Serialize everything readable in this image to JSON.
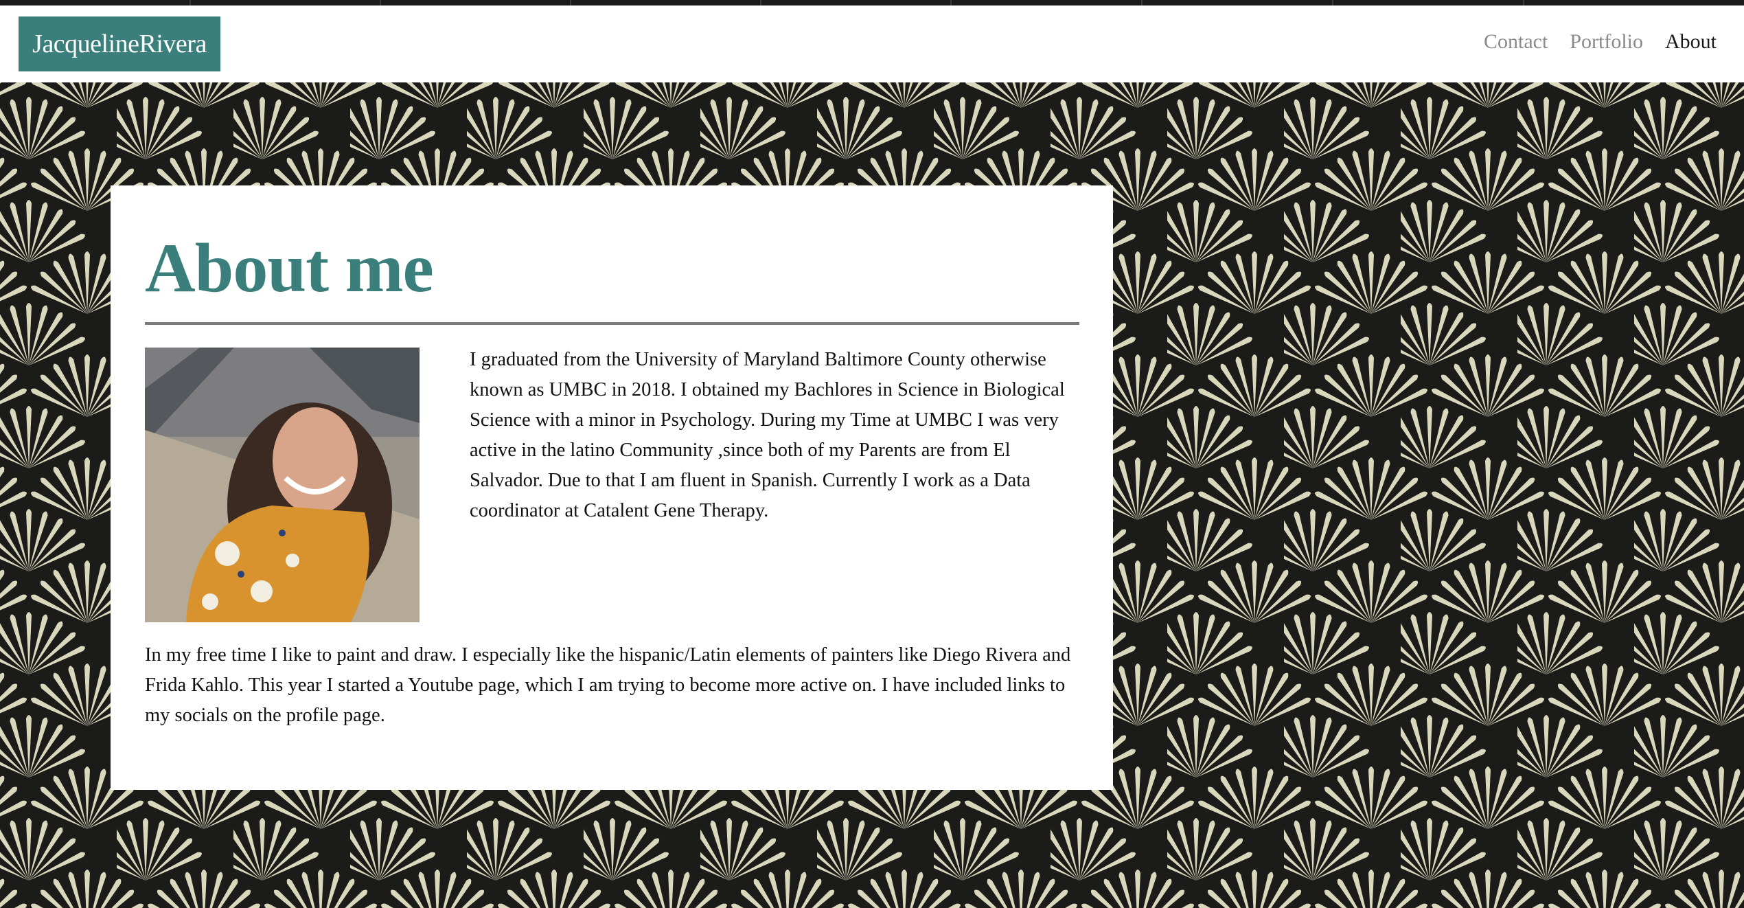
{
  "header": {
    "brand": "JacquelineRivera",
    "nav": [
      {
        "label": "Contact",
        "active": false
      },
      {
        "label": "Portfolio",
        "active": false
      },
      {
        "label": "About",
        "active": true
      }
    ]
  },
  "main": {
    "title": "About me",
    "bio_paragraph_1": "I graduated from the University of Maryland Baltimore County otherwise known as UMBC in 2018. I obtained my Bachlores in Science in Biological Science with a minor in Psychology. During my Time at UMBC I was very active in the latino Community ,since both of my Parents are from El Salvador. Due to that I am fluent in Spanish. Currently I work as a Data coordinator at Catalent Gene Therapy.",
    "bio_paragraph_2": "In my free time I like to paint and draw. I especially like the hispanic/Latin elements of painters like Diego Rivera and Frida Kahlo. This year I started a Youtube page, which I am trying to become more active on. I have included links to my socials on the profile page."
  },
  "colors": {
    "accent": "#3b7f7d",
    "pattern_light": "#d9d8bd",
    "pattern_dark": "#1b1b19"
  }
}
